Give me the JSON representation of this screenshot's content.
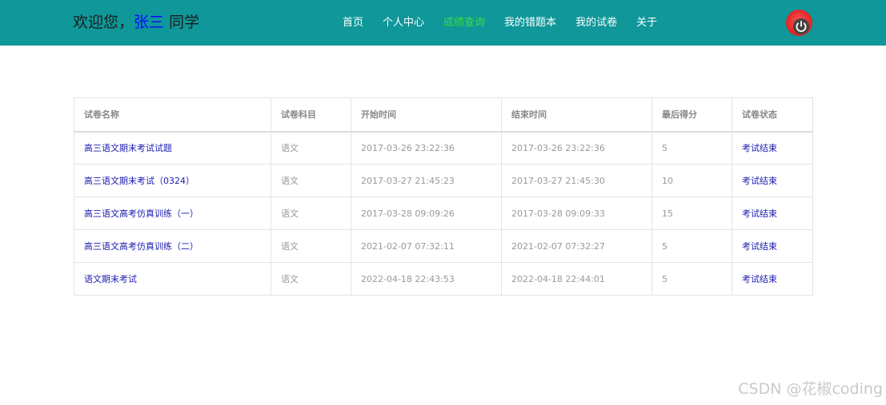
{
  "header": {
    "welcome_prefix": "欢迎您，",
    "username": "张三",
    "welcome_suffix": " 同学",
    "nav": [
      {
        "label": "首页",
        "active": false
      },
      {
        "label": "个人中心",
        "active": false
      },
      {
        "label": "成绩查询",
        "active": true
      },
      {
        "label": "我的错题本",
        "active": false
      },
      {
        "label": "我的试卷",
        "active": false
      },
      {
        "label": "关于",
        "active": false
      }
    ],
    "bar_color": "#0f9799",
    "active_color": "#3ddc3d",
    "power_icon": "power-icon"
  },
  "table": {
    "columns": [
      "试卷名称",
      "试卷科目",
      "开始时间",
      "结束时间",
      "最后得分",
      "试卷状态"
    ],
    "rows": [
      {
        "name": "高三语文期末考试试题",
        "subject": "语文",
        "start": "2017-03-26 23:22:36",
        "end": "2017-03-26 23:22:36",
        "score": "5",
        "status": "考试结束"
      },
      {
        "name": "高三语文期末考试（0324）",
        "subject": "语文",
        "start": "2017-03-27 21:45:23",
        "end": "2017-03-27 21:45:30",
        "score": "10",
        "status": "考试结束"
      },
      {
        "name": "高三语文高考仿真训练（一）",
        "subject": "语文",
        "start": "2017-03-28 09:09:26",
        "end": "2017-03-28 09:09:33",
        "score": "15",
        "status": "考试结束"
      },
      {
        "name": "高三语文高考仿真训练（二）",
        "subject": "语文",
        "start": "2021-02-07 07:32:11",
        "end": "2021-02-07 07:32:27",
        "score": "5",
        "status": "考试结束"
      },
      {
        "name": "语文期末考试",
        "subject": "语文",
        "start": "2022-04-18 22:43:53",
        "end": "2022-04-18 22:44:01",
        "score": "5",
        "status": "考试结束"
      }
    ]
  },
  "watermark": "CSDN @花椒coding"
}
